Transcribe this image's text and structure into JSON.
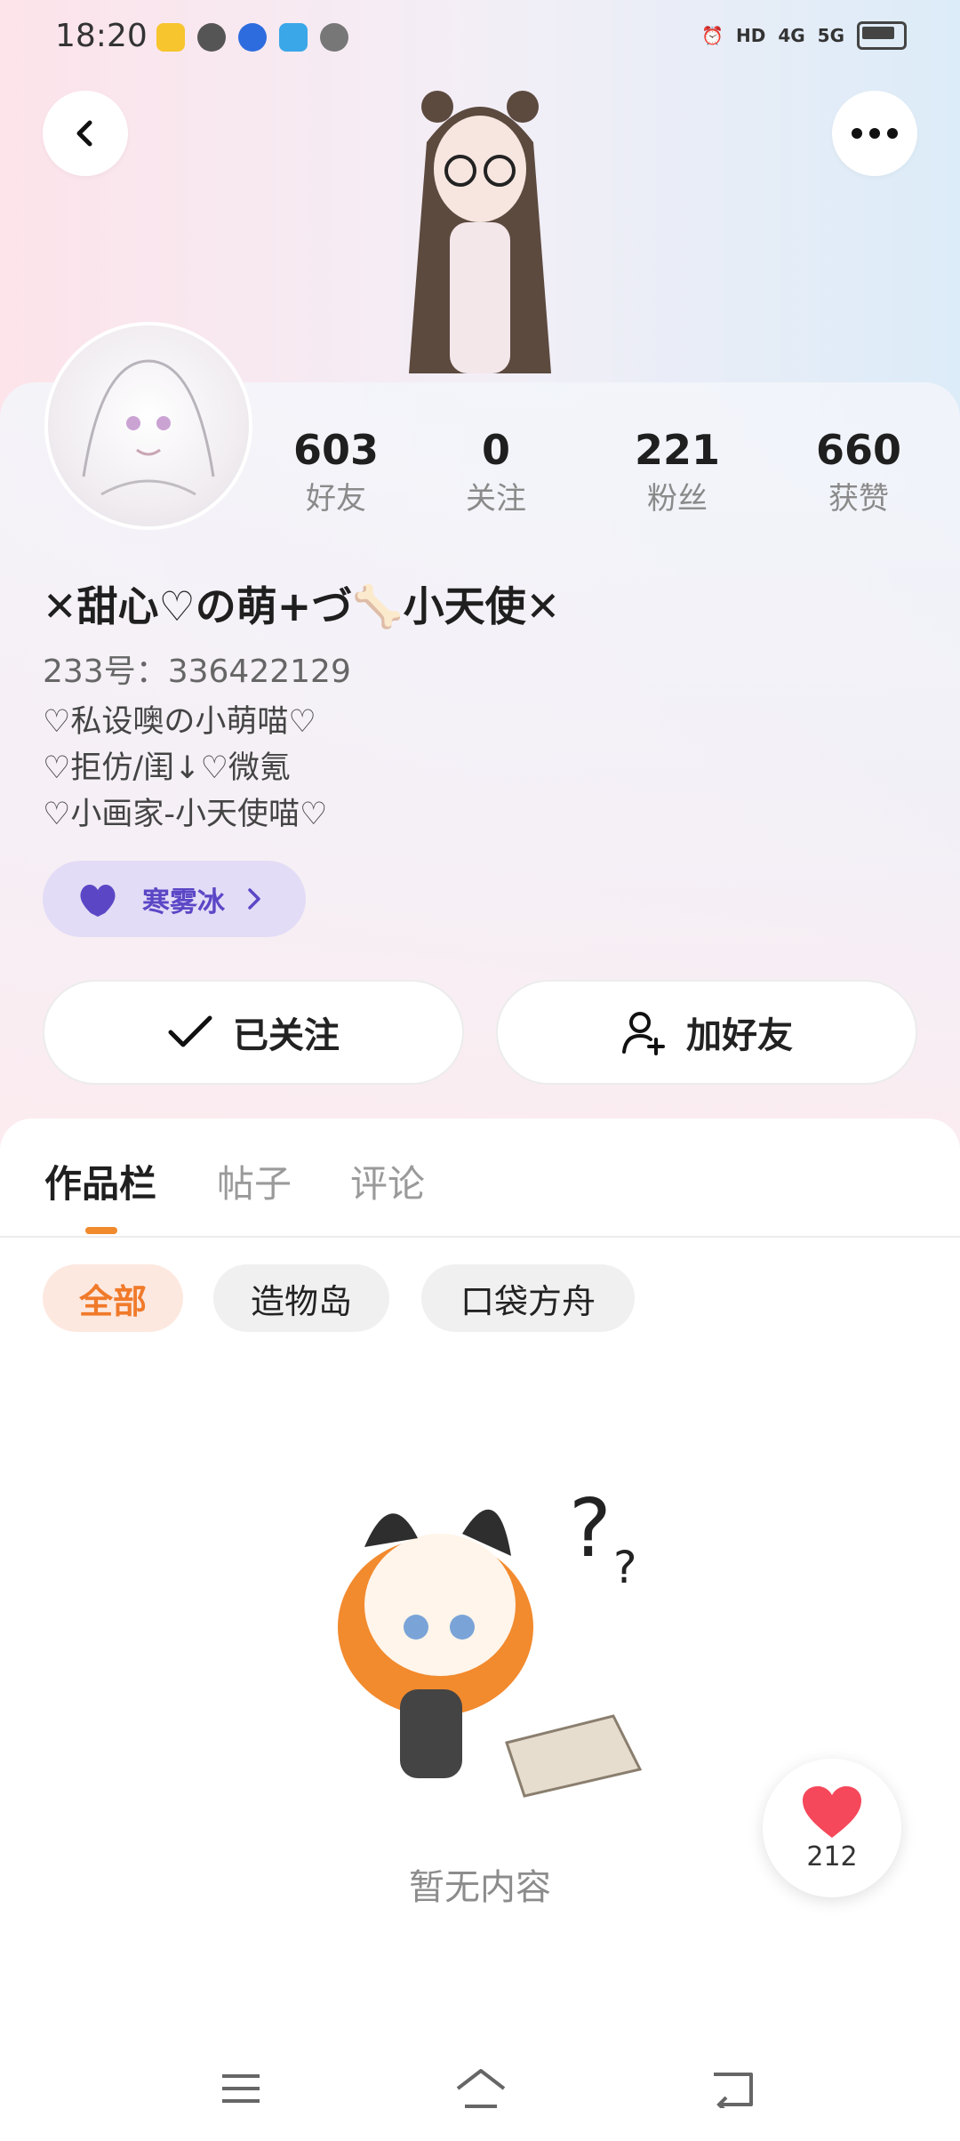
{
  "status_bar": {
    "time": "18:20",
    "network_4g": "4G",
    "network_5g": "5G",
    "hd": "HD"
  },
  "profile": {
    "stats": [
      {
        "value": "603",
        "label": "好友"
      },
      {
        "value": "0",
        "label": "关注"
      },
      {
        "value": "221",
        "label": "粉丝"
      },
      {
        "value": "660",
        "label": "获赞"
      }
    ],
    "nickname": "✕甜心♡の萌+づ🦴小天使✕",
    "uid": "233号：336422129",
    "bio": [
      "♡私设噢の小萌喵♡",
      "♡拒仿/闺↓♡微氪",
      "♡小画家-小天使喵♡"
    ],
    "tag": {
      "label": "寒雾冰",
      "color": "#5b47c6",
      "icon": "heart-icon"
    }
  },
  "actions": {
    "follow_label": "已关注",
    "add_friend_label": "加好友"
  },
  "tabs": [
    {
      "label": "作品栏",
      "active": true
    },
    {
      "label": "帖子",
      "active": false
    },
    {
      "label": "评论",
      "active": false
    }
  ],
  "filters": [
    {
      "label": "全部",
      "active": true
    },
    {
      "label": "造物岛",
      "active": false
    },
    {
      "label": "口袋方舟",
      "active": false
    }
  ],
  "empty_state": {
    "text": "暂无内容"
  },
  "like_float": {
    "count": "212"
  },
  "colors": {
    "accent": "#f07a2a",
    "tag_purple": "#5b47c6",
    "like_red": "#f5485a"
  }
}
